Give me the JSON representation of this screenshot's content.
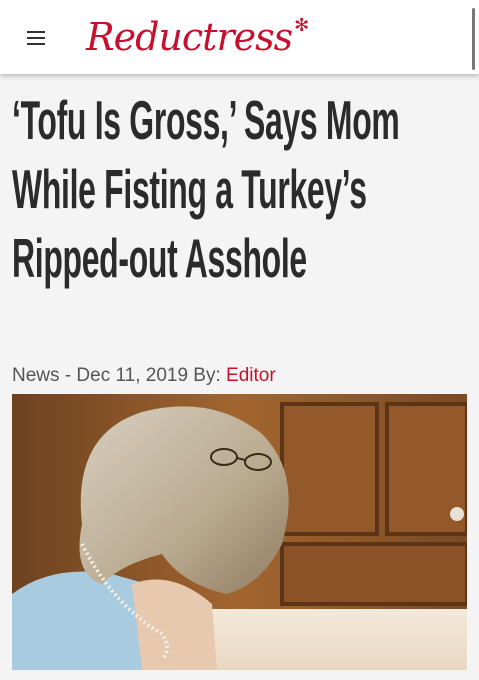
{
  "header": {
    "menu_icon": "hamburger-menu-icon",
    "logo_text": "Reductress",
    "logo_mark": "✻",
    "brand_color": "#c8102e"
  },
  "article": {
    "headline": "‘Tofu Is Gross,’ Says Mom While Fisting a Turkey’s Ripped-out Asshole",
    "category": "News",
    "separator": " - ",
    "date": "Dec 11, 2019",
    "by_label": " By: ",
    "author": "Editor"
  }
}
